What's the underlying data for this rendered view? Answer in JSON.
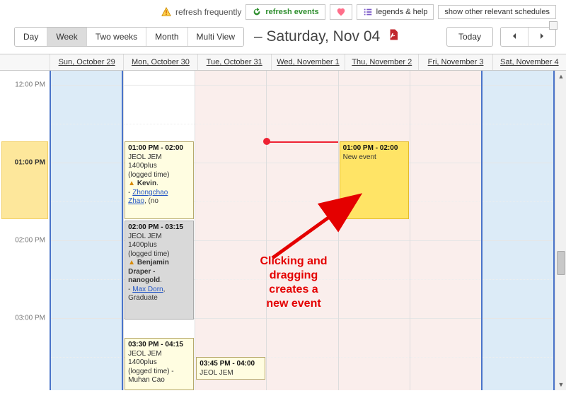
{
  "linkbar": {
    "refresh_note": "refresh frequently",
    "refresh_events": "refresh events",
    "legends": "legends & help",
    "other_schedules": "show other relevant schedules"
  },
  "views": {
    "day": "Day",
    "week": "Week",
    "two_weeks": "Two weeks",
    "month": "Month",
    "multi": "Multi View"
  },
  "title_fragment": " – Saturday, Nov 04",
  "toolbar": {
    "today": "Today"
  },
  "days": {
    "sun": "Sun, October 29",
    "mon": "Mon, October 30",
    "tue": "Tue, October 31",
    "wed": "Wed, November 1",
    "thu": "Thu, November 2",
    "fri": "Fri, November 3",
    "sat": "Sat, November 4"
  },
  "times": {
    "t12": "12:00 PM",
    "t13": "01:00 PM",
    "t14": "02:00 PM",
    "t15": "03:00 PM"
  },
  "events": {
    "mon1": {
      "time": "01:00 PM - 02:00",
      "l1": "JEOL JEM",
      "l2": "1400plus",
      "l3": "(logged time)",
      "warn_name": "Kevin",
      "link1": "Zhongchao",
      "link2": "Zhao",
      "tail": ", (no"
    },
    "mon2": {
      "time": "02:00 PM - 03:15",
      "l1": "JEOL JEM",
      "l2": "1400plus",
      "l3": "(logged time)",
      "warn_name1": "Benjamin",
      "warn_name2": "Draper -",
      "warn_name3": "nanogold",
      "link": "Max Dorn",
      "tail": "Graduate"
    },
    "mon3": {
      "time": "03:30 PM - 04:15",
      "l1": "JEOL JEM",
      "l2": "1400plus",
      "l3": "(logged time) -",
      "tail": "Muhan Cao"
    },
    "tue1": {
      "time": "03:45 PM - 04:00",
      "l1": "JEOL JEM"
    },
    "thu_new": {
      "time": "01:00 PM - 02:00",
      "label": "New event"
    }
  },
  "annotation": {
    "l1": "Clicking and",
    "l2": "dragging",
    "l3": "creates a",
    "l4": "new event"
  }
}
